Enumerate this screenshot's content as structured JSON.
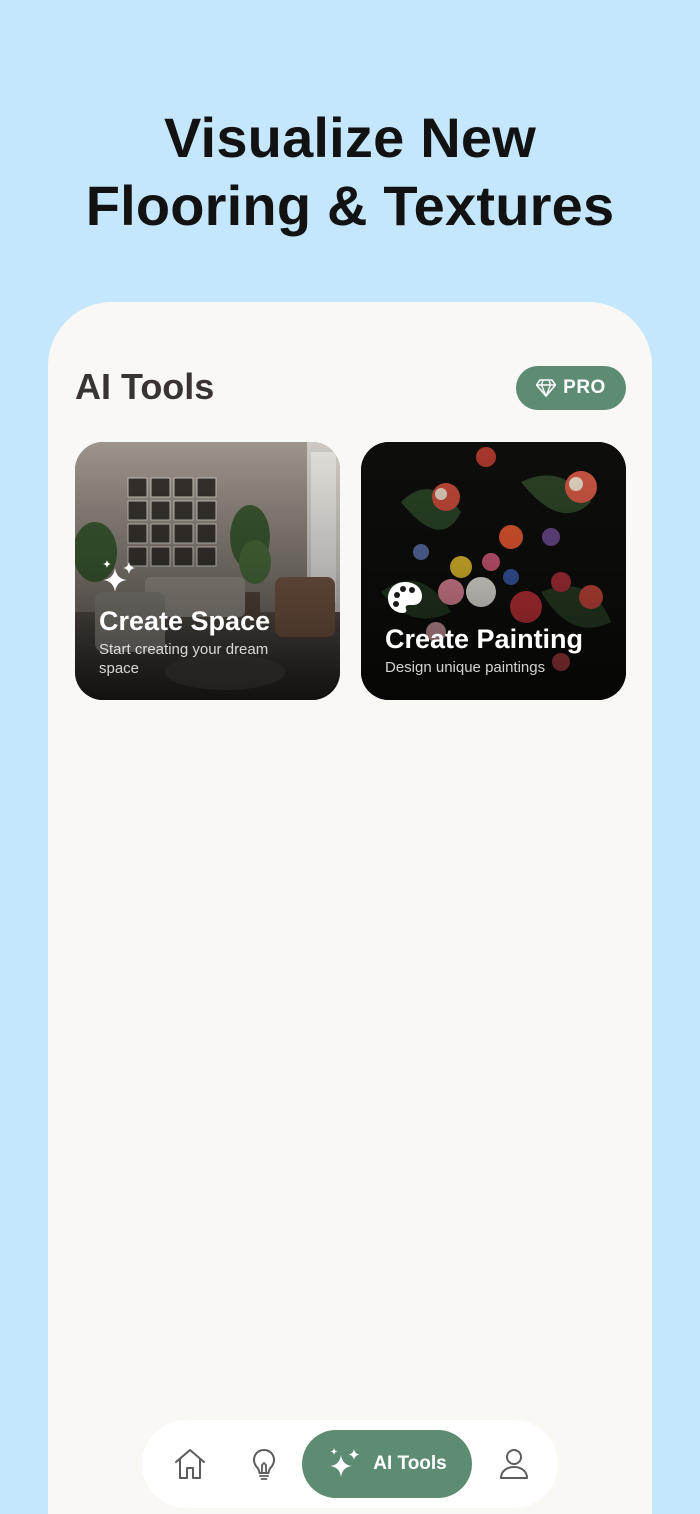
{
  "headline": {
    "line1": "Visualize New",
    "line2": "Flooring & Textures"
  },
  "header": {
    "title": "AI Tools",
    "pro_label": "PRO",
    "pro_icon": "diamond-icon"
  },
  "cards": [
    {
      "title": "Create Space",
      "subtitle": "Start creating your dream space",
      "icon": "sparkles-icon"
    },
    {
      "title": "Create Painting",
      "subtitle": "Design unique paintings",
      "icon": "palette-icon"
    }
  ],
  "tab_bar": {
    "items": [
      {
        "icon": "home-icon",
        "active": false
      },
      {
        "icon": "lightbulb-icon",
        "active": false
      },
      {
        "icon": "sparkles-icon",
        "label": "AI Tools",
        "active": true
      },
      {
        "icon": "profile-icon",
        "active": false
      }
    ]
  },
  "colors": {
    "background": "#c4e7fd",
    "surface": "#f9f8f5",
    "accent": "#5e8c73",
    "title_text": "#3a3431"
  }
}
